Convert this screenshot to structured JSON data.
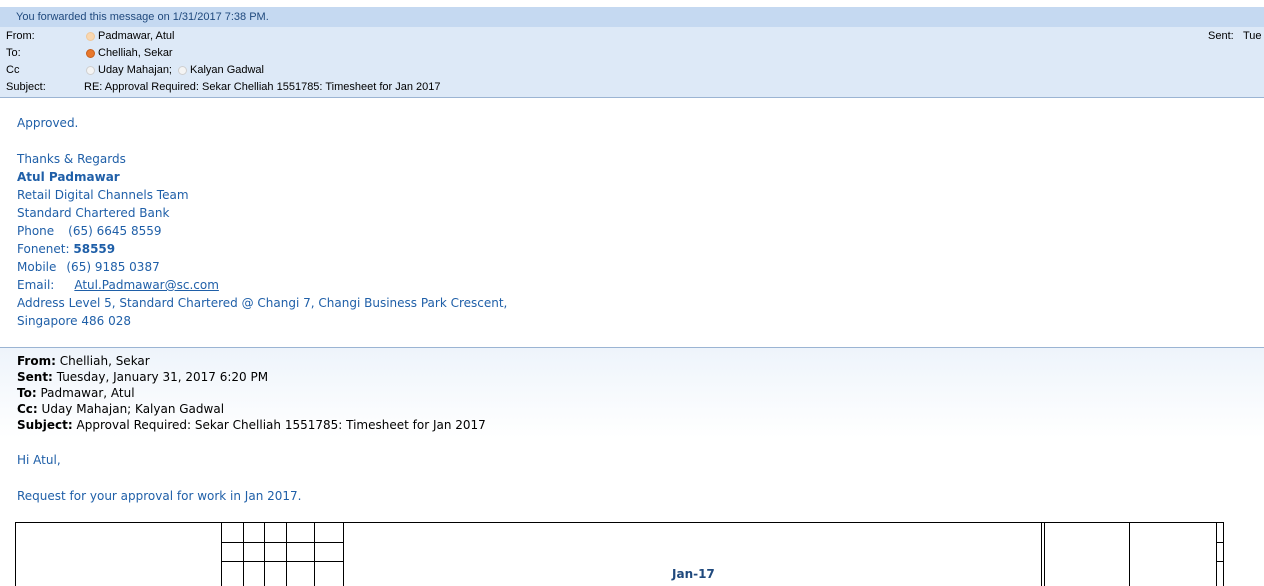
{
  "infobar": {
    "text": "You forwarded this message on 1/31/2017 7:38 PM."
  },
  "header": {
    "from_label": "From:",
    "from_value": "Padmawar, Atul",
    "to_label": "To:",
    "to_value": "Chelliah, Sekar",
    "cc_label": "Cc",
    "cc_values": [
      "Uday Mahajan;",
      "Kalyan Gadwal"
    ],
    "subject_label": "Subject:",
    "subject_value": "RE: Approval Required: Sekar Chelliah 1551785: Timesheet for Jan 2017",
    "sent_label": "Sent:",
    "sent_value": "Tue"
  },
  "reply": {
    "approved": "Approved.",
    "regards": "Thanks & Regards",
    "name": "Atul Padmawar",
    "team": "Retail Digital Channels Team",
    "bank": "Standard Chartered Bank",
    "phone_label": "Phone",
    "phone_value": "(65) 6645 8559",
    "fonenet_label": "Fonenet:",
    "fonenet_value": "58559",
    "mobile_label": "Mobile",
    "mobile_value": "(65) 9185 0387",
    "email_label": "Email:",
    "email_value": "Atul.Padmawar@sc.com",
    "address_line1": "Address Level 5, Standard Chartered @ Changi 7, Changi Business Park Crescent,",
    "address_line2": "Singapore 486 028"
  },
  "forwarded": {
    "from_label": "From:",
    "from_value": "Chelliah, Sekar",
    "sent_label": "Sent:",
    "sent_value": "Tuesday, January 31, 2017 6:20 PM",
    "to_label": "To:",
    "to_value": "Padmawar, Atul",
    "cc_label": "Cc:",
    "cc_value": "Uday Mahajan; Kalyan Gadwal",
    "subject_label": "Subject:",
    "subject_value": "Approval Required: Sekar Chelliah 1551785: Timesheet for Jan 2017",
    "greeting": "Hi Atul,",
    "request": "Request for your approval for work in Jan 2017."
  },
  "table": {
    "month_header": "Jan-17"
  }
}
